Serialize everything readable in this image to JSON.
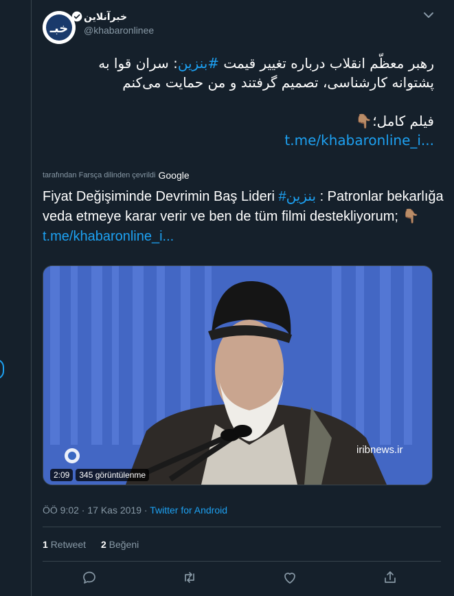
{
  "author": {
    "display_name": "خبرآنلاین",
    "handle": "@khabaronlinee",
    "avatar_text": "خبـ"
  },
  "tweet": {
    "line1_pre": "رهبر معظّم انقلاب درباره تغییر قیمت ",
    "hashtag": "#بنزین",
    "line1_post": ": سران قوا به",
    "line2": "پشتوانه کارشناسی، تصمیم گرفتند و من حمایت می‌کنم",
    "line3": "فیلم کامل؛👇🏽",
    "link": "t.me/khabaronline_i..."
  },
  "translation": {
    "translated_by": "tarafından Farsça dilinden çevrildi",
    "google": "Google",
    "text_pre": "Fiyat Değişiminde Devrimin Baş Lideri ",
    "hashtag": "#بنزین",
    "text_post": " : Patronlar bekarlığa veda etmeye karar verir ve ben de tüm filmi destekliyorum; 👇🏽 ",
    "link": "t.me/khabaronline_i..."
  },
  "video": {
    "duration": "2:09",
    "views": "345 görüntülenme",
    "watermark": "iribnews.ir"
  },
  "meta": {
    "time": "ÖÖ 9:02",
    "separator": " · ",
    "date": "17 Kas 2019",
    "source": "Twitter for Android"
  },
  "stats": {
    "retweet_count": "1",
    "retweet_label": "Retweet",
    "like_count": "2",
    "like_label": "Beğeni"
  },
  "colors": {
    "background": "#15202b",
    "accent": "#1da1f2",
    "secondary_text": "#8899a6",
    "border": "#38444d"
  },
  "icons": [
    "verified-icon",
    "chevron-down-icon",
    "reply-icon",
    "retweet-icon",
    "like-icon",
    "share-icon"
  ]
}
